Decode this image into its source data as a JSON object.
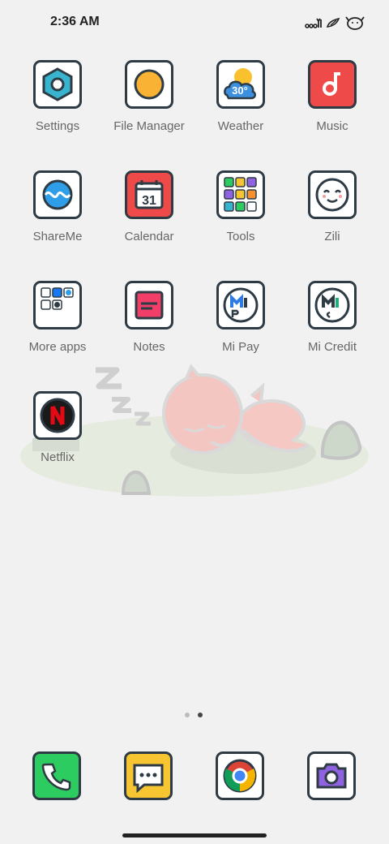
{
  "status_bar": {
    "time": "2:36 AM",
    "icons": [
      "signal-icon",
      "wifi-icon",
      "battery-icon"
    ]
  },
  "apps": [
    {
      "label": "Settings",
      "icon": "settings-icon"
    },
    {
      "label": "File Manager",
      "icon": "file-manager-icon"
    },
    {
      "label": "Weather",
      "icon": "weather-icon",
      "badge": "30°"
    },
    {
      "label": "Music",
      "icon": "music-icon"
    },
    {
      "label": "ShareMe",
      "icon": "shareme-icon"
    },
    {
      "label": "Calendar",
      "icon": "calendar-icon",
      "badge": "31"
    },
    {
      "label": "Tools",
      "icon": "tools-folder-icon"
    },
    {
      "label": "Zili",
      "icon": "zili-icon"
    },
    {
      "label": "More apps",
      "icon": "more-apps-folder-icon"
    },
    {
      "label": "Notes",
      "icon": "notes-icon"
    },
    {
      "label": "Mi Pay",
      "icon": "mi-pay-icon"
    },
    {
      "label": "Mi Credit",
      "icon": "mi-credit-icon"
    },
    {
      "label": "Netflix",
      "icon": "netflix-icon"
    }
  ],
  "dock": [
    {
      "icon": "phone-icon"
    },
    {
      "icon": "messages-icon"
    },
    {
      "icon": "chrome-icon"
    },
    {
      "icon": "camera-icon"
    }
  ],
  "page_indicator": {
    "pages": 2,
    "current": 2
  },
  "colors": {
    "background": "#f1f1f1",
    "tile_border": "#2f3b44",
    "music_red": "#ef4a4a",
    "calendar_red": "#ef4a4a",
    "phone_green": "#2dcc60",
    "messages_yellow": "#f7c531",
    "camera_purple": "#8e62e0",
    "notes_pink": "#f23f6a"
  }
}
